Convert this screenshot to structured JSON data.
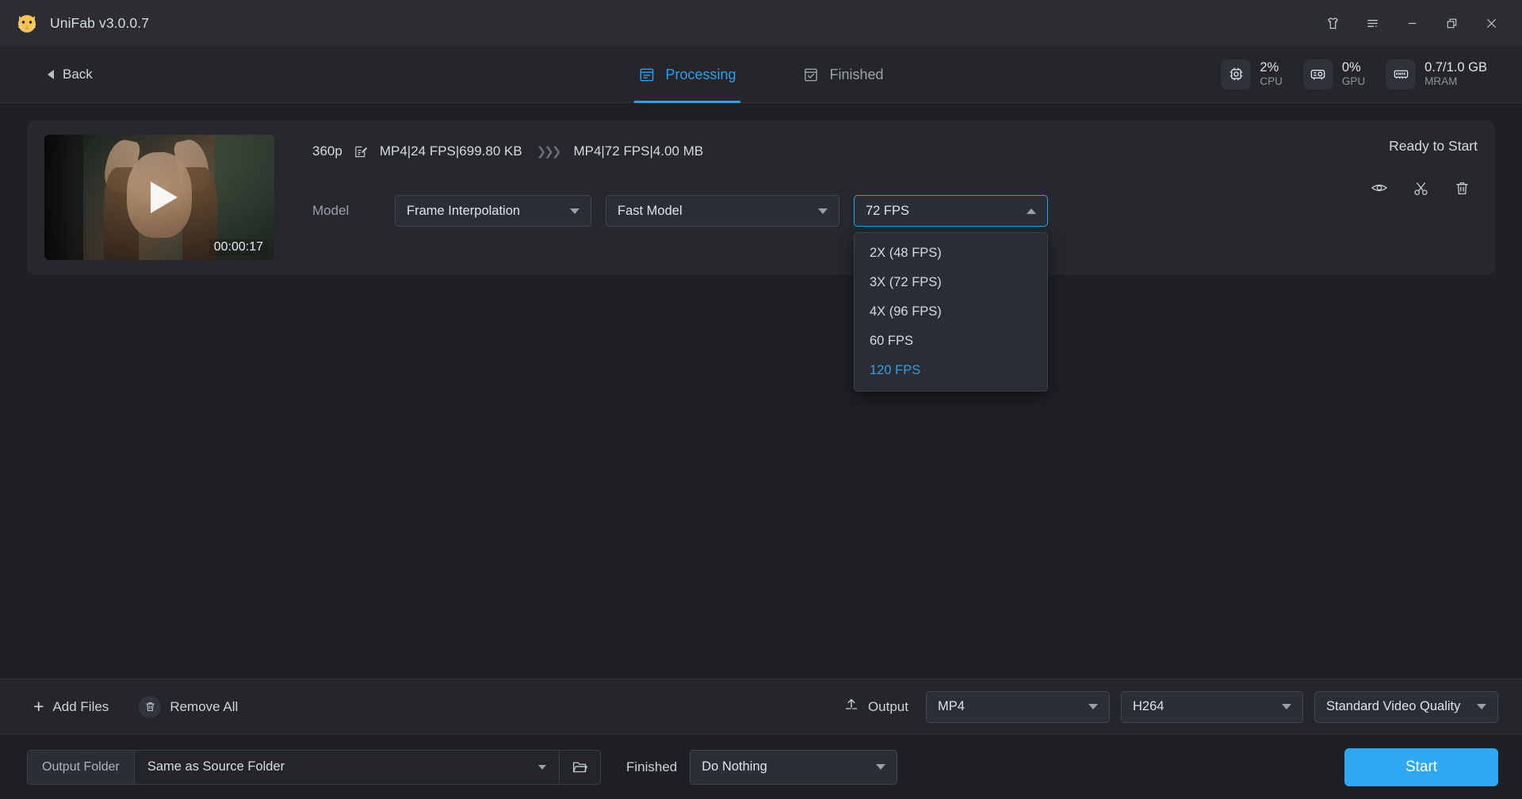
{
  "window": {
    "app_title": "UniFab v3.0.0.7",
    "logo_icon": "cat-logo-icon",
    "controls": [
      {
        "name": "theme-icon",
        "label": "Theme"
      },
      {
        "name": "menu-icon",
        "label": "Menu"
      },
      {
        "name": "minimize-icon",
        "label": "Minimize"
      },
      {
        "name": "maximize-icon",
        "label": "Maximize"
      },
      {
        "name": "close-icon",
        "label": "Close"
      }
    ]
  },
  "nav": {
    "back_label": "Back",
    "tabs": [
      {
        "label": "Processing",
        "icon": "processing-icon",
        "active": true
      },
      {
        "label": "Finished",
        "icon": "finished-icon",
        "active": false
      }
    ],
    "stats": [
      {
        "icon": "cpu-icon",
        "value": "2%",
        "label": "CPU"
      },
      {
        "icon": "gpu-icon",
        "value": "0%",
        "label": "GPU"
      },
      {
        "icon": "mram-icon",
        "value": "0.7/1.0 GB",
        "label": "MRAM"
      }
    ]
  },
  "file_card": {
    "thumbnail": {
      "duration": "00:00:17",
      "play_icon": "play-icon"
    },
    "resolution": "360p",
    "edit_icon": "edit-icon",
    "source_info": "MP4|24 FPS|699.80 KB",
    "convert_icon": "chevrons-right-icon",
    "target_info": "MP4|72 FPS|4.00 MB",
    "model_label": "Model",
    "model_select": {
      "value": "Frame Interpolation"
    },
    "speed_select": {
      "value": "Fast Model"
    },
    "fps_select": {
      "value": "72 FPS",
      "open": true,
      "options": [
        {
          "label": "2X (48 FPS)",
          "selected": false
        },
        {
          "label": "3X (72 FPS)",
          "selected": false
        },
        {
          "label": "4X (96 FPS)",
          "selected": false
        },
        {
          "label": "60 FPS",
          "selected": false
        },
        {
          "label": "120 FPS",
          "selected": true
        }
      ]
    },
    "status": "Ready to Start",
    "actions": [
      {
        "name": "preview-icon",
        "label": "Preview"
      },
      {
        "name": "trim-scissors-icon",
        "label": "Trim"
      },
      {
        "name": "delete-trash-icon",
        "label": "Delete"
      }
    ]
  },
  "output_bar": {
    "add_files_label": "Add Files",
    "add_files_icon": "plus-icon",
    "remove_all_label": "Remove All",
    "remove_all_icon": "trash-icon",
    "output_label": "Output",
    "output_icon": "upload-icon",
    "container_select": {
      "value": "MP4"
    },
    "codec_select": {
      "value": "H264"
    },
    "quality_select": {
      "value": "Standard Video Quality"
    }
  },
  "footer": {
    "output_folder_label": "Output Folder",
    "output_folder_value": "Same as Source Folder",
    "browse_icon": "folder-open-icon",
    "finished_label": "Finished",
    "finished_action": "Do Nothing",
    "start_label": "Start"
  },
  "colors": {
    "accent": "#2f9dee",
    "start_button": "#2ea8f3",
    "titlebar_bg": "#2b2d33",
    "navbar_bg": "#242629",
    "page_bg": "#1e2023",
    "card_bg": "#26282d"
  }
}
